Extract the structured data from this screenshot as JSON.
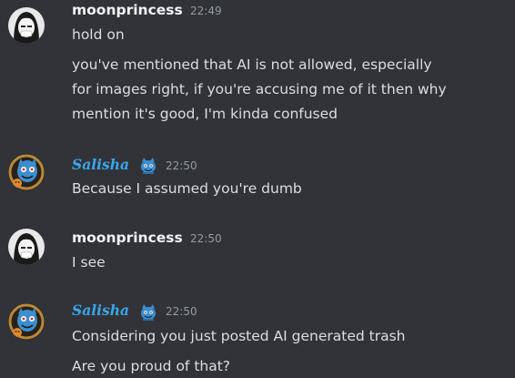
{
  "messages": [
    {
      "author": "moonprincess",
      "time": "22:49",
      "lines": [
        "hold on",
        "you've mentioned that AI is not allowed, especially",
        "for images right, if you're accusing me of it then why",
        "mention it's good, I'm kinda confused"
      ]
    },
    {
      "author": "Salisha",
      "time": "22:50",
      "lines": [
        "Because I assumed you're dumb"
      ]
    },
    {
      "author": "moonprincess",
      "time": "22:50",
      "lines": [
        "I see"
      ]
    },
    {
      "author": "Salisha",
      "time": "22:50",
      "lines": [
        "Considering you just posted AI generated trash",
        "Are you proud of that?"
      ]
    }
  ],
  "colors": {
    "background": "#313338",
    "text": "#dbdee1",
    "username_moonprincess": "#f2f3f5",
    "username_salisha": "#3aa6e8",
    "timestamp": "#949ba4"
  },
  "icons": {
    "moonprincess_avatar": "anime-girl-avatar-icon",
    "salisha_avatar": "blue-monster-avatar-icon",
    "salisha_badge": "blue-creature-badge-icon"
  }
}
